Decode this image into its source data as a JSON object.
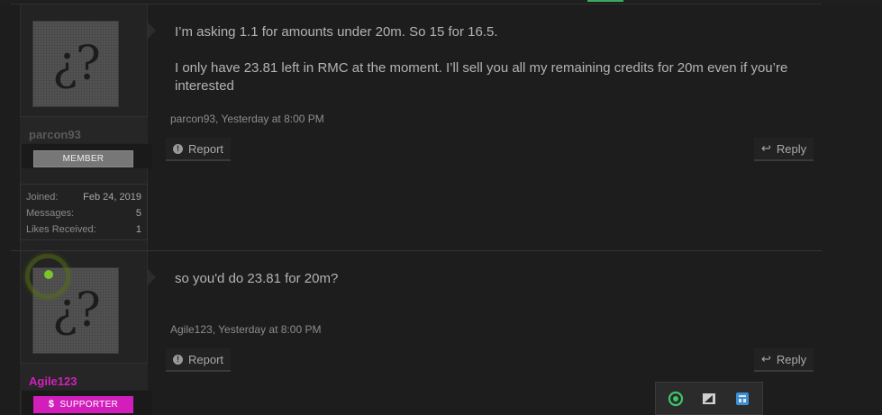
{
  "posts": [
    {
      "username": "parcon93",
      "user_title": "MEMBER",
      "extra": [
        {
          "label": "Joined:",
          "value": "Feb 24, 2019"
        },
        {
          "label": "Messages:",
          "value": "5"
        },
        {
          "label": "Likes Received:",
          "value": "1"
        }
      ],
      "message": [
        "I’m asking 1.1 for amounts under 20m. So 15 for 16.5.",
        "I only have 23.81 left in RMC at the moment. I’ll sell you all my remaining credits for 20m even if you’re interested"
      ],
      "meta": "parcon93, Yesterday at 8:00 PM",
      "report_label": "Report",
      "reply_label": "Reply"
    },
    {
      "username": "Agile123",
      "user_title": "SUPPORTER",
      "username_color": "#d21fbc",
      "message": [
        "so you'd do 23.81 for 20m?"
      ],
      "meta": "Agile123, Yesterday at 8:00 PM",
      "report_label": "Report",
      "reply_label": "Reply"
    }
  ],
  "avatar_glyph": "¿?",
  "supporter_icon": "$",
  "online_status": "online",
  "tray_icons": [
    "chat-app-icon",
    "gesture-app-icon",
    "network-app-icon"
  ],
  "colors": {
    "background": "#1d1d1d",
    "accent": "#3aaa5a",
    "supporter": "#d21fbc",
    "online": "#7bc42a"
  }
}
